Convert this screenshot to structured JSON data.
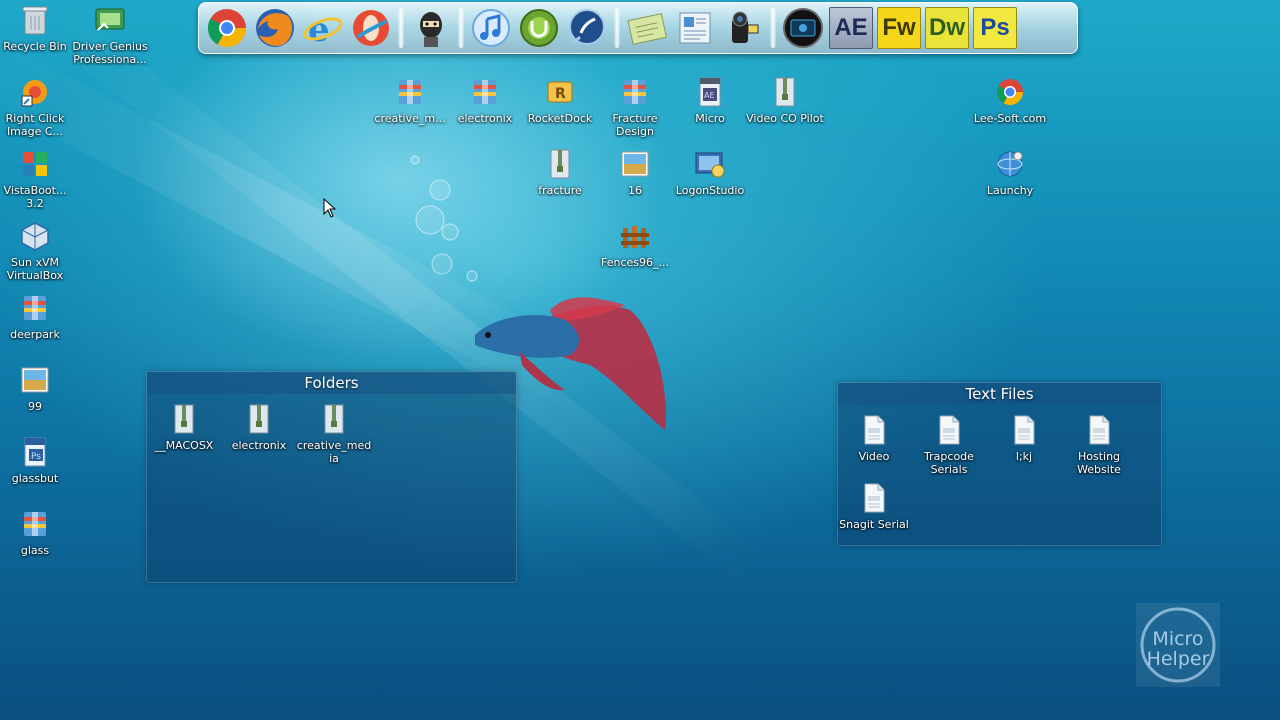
{
  "desktop": {
    "left_icons": [
      {
        "label": "Recycle Bin",
        "icon": "recycle-bin-icon"
      },
      {
        "label": "Driver Genius Professiona...",
        "icon": "driver-genius-icon"
      },
      {
        "label": "Right Click Image C...",
        "icon": "right-click-image-icon"
      },
      {
        "label": "VistaBoot... 3.2",
        "icon": "vistaboot-icon"
      },
      {
        "label": "Sun xVM VirtualBox",
        "icon": "virtualbox-icon"
      },
      {
        "label": "deerpark",
        "icon": "archive-icon"
      },
      {
        "label": "99",
        "icon": "image-file-icon"
      },
      {
        "label": "glassbut",
        "icon": "psd-file-icon"
      },
      {
        "label": "glass",
        "icon": "archive-icon"
      }
    ],
    "center_icons": [
      {
        "label": "creative_m...",
        "icon": "archive-icon"
      },
      {
        "label": "electronix",
        "icon": "archive-icon"
      },
      {
        "label": "RocketDock",
        "icon": "rocketdock-icon"
      },
      {
        "label": "Fracture Design",
        "icon": "archive-icon"
      },
      {
        "label": "Micro",
        "icon": "aep-file-icon"
      },
      {
        "label": "Video CO Pilot",
        "icon": "zip-folder-icon"
      },
      {
        "label": "fracture",
        "icon": "zip-folder-icon"
      },
      {
        "label": "16",
        "icon": "image-file-icon"
      },
      {
        "label": "LogonStudio",
        "icon": "logonstudio-icon"
      },
      {
        "label": "Fences96_...",
        "icon": "fences-icon"
      }
    ],
    "right_icons": [
      {
        "label": "Lee-Soft.com",
        "icon": "chrome-shortcut-icon"
      },
      {
        "label": "Launchy",
        "icon": "launchy-icon"
      }
    ]
  },
  "dock": {
    "items": [
      {
        "name": "chrome",
        "icon": "chrome-icon"
      },
      {
        "name": "firefox",
        "icon": "firefox-icon"
      },
      {
        "name": "internet explorer",
        "icon": "ie-icon"
      },
      {
        "name": "opera",
        "icon": "opera-icon"
      },
      {
        "name": "ninja",
        "icon": "ninja-icon"
      },
      {
        "name": "itunes",
        "icon": "itunes-icon"
      },
      {
        "name": "torrent",
        "icon": "utorrent-icon"
      },
      {
        "name": "quicktime",
        "icon": "quicktime-icon"
      },
      {
        "name": "notes",
        "icon": "notes-icon"
      },
      {
        "name": "documents",
        "icon": "documents-icon"
      },
      {
        "name": "video camera",
        "icon": "video-camera-icon"
      },
      {
        "name": "media center",
        "icon": "media-center-icon"
      }
    ],
    "adobe": [
      {
        "text": "AE",
        "icon": "after-effects-icon"
      },
      {
        "text": "Fw",
        "icon": "fireworks-icon"
      },
      {
        "text": "Dw",
        "icon": "dreamweaver-icon"
      },
      {
        "text": "Ps",
        "icon": "photoshop-icon"
      }
    ]
  },
  "fences": {
    "folders": {
      "title": "Folders",
      "items": [
        {
          "label": "__MACOSX",
          "icon": "zip-folder-icon"
        },
        {
          "label": "electronix",
          "icon": "zip-folder-icon"
        },
        {
          "label": "creative_med ia",
          "icon": "zip-folder-icon"
        }
      ]
    },
    "text_files": {
      "title": "Text Files",
      "items": [
        {
          "label": "Video",
          "icon": "txt-file-icon"
        },
        {
          "label": "Trapcode Serials",
          "icon": "txt-file-icon"
        },
        {
          "label": "l;kj",
          "icon": "txt-file-icon"
        },
        {
          "label": "Hosting Website",
          "icon": "txt-file-icon"
        },
        {
          "label": "Snagit Serial",
          "icon": "txt-file-icon"
        }
      ]
    }
  },
  "watermark": {
    "line1": "Micro",
    "line2": "Helper"
  },
  "colors": {
    "accent": "#1fa9c9",
    "fence_bg": "#103c69"
  }
}
